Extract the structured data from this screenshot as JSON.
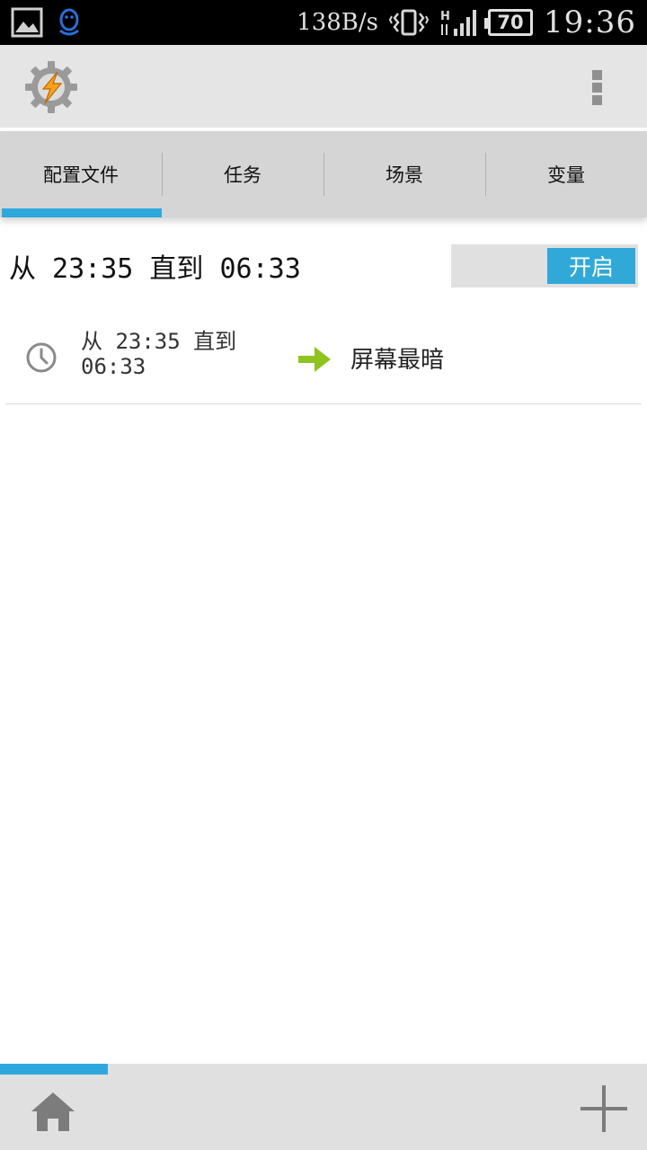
{
  "status_bar": {
    "left_icons": [
      "gallery-icon",
      "qq-icon"
    ],
    "net_speed": "138B/s",
    "right_icons": [
      "vibrate-icon",
      "hspa-signal-icon"
    ],
    "battery": "70",
    "time": "19:36"
  },
  "action_bar": {
    "app_icon": "tasker-gear-icon",
    "menu_icon": "overflow-menu-icon"
  },
  "tabs": [
    {
      "label": "配置文件",
      "active": true
    },
    {
      "label": "任务",
      "active": false
    },
    {
      "label": "场景",
      "active": false
    },
    {
      "label": "变量",
      "active": false
    }
  ],
  "profile": {
    "title": "从 23:35 直到 06:33",
    "toggle_label": "开启",
    "context_icon": "clock-icon",
    "context_text": "从 23:35 直到 06:33",
    "arrow_icon": "arrow-right-icon",
    "task_name": "屏幕最暗"
  },
  "bottom_bar": {
    "home_icon": "home-icon",
    "add_icon": "add-icon"
  },
  "colors": {
    "accent": "#2ea8dc",
    "toggle_on": "#31a9d8",
    "arrow": "#8fc31f",
    "tab_bg": "#d5d5d5",
    "actionbar_bg": "#e5e5e5"
  }
}
